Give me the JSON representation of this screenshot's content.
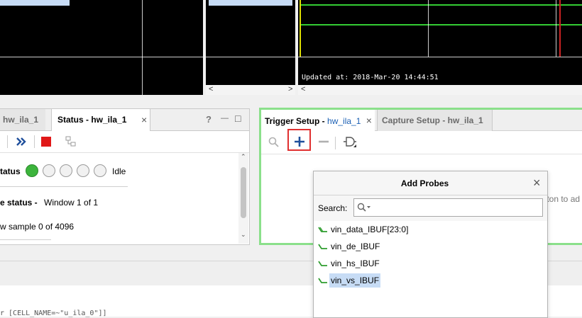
{
  "waveform": {
    "updated_text": "Updated at: 2018-Mar-20 14:44:51",
    "scroll_left": "<",
    "scroll_right": ">"
  },
  "status_panel": {
    "tab_left": "hw_ila_1",
    "tab_active": "Status - hw_ila_1",
    "tab_close": "×",
    "help": "?",
    "minimize": "—",
    "maximize": "□",
    "core_status_label": "tatus",
    "idle_label": "Idle",
    "capture_status_label": "e status -",
    "capture_status_value": "Window 1 of 1",
    "sample_text": "w sample 0 of 4096"
  },
  "trigger_panel": {
    "tab_trigger_prefix": "Trigger Setup - ",
    "tab_trigger_link": "hw_ila_1",
    "tab_close": "×",
    "tab_capture": "Capture Setup - hw_ila_1",
    "hint_text": "tton to ad"
  },
  "dialog": {
    "title": "Add Probes",
    "close": "×",
    "search_label": "Search:",
    "search_value": "",
    "probes": [
      {
        "name": "vin_data_IBUF[23:0]",
        "selected": false
      },
      {
        "name": "vin_de_IBUF",
        "selected": false
      },
      {
        "name": "vin_hs_IBUF",
        "selected": false
      },
      {
        "name": "vin_vs_IBUF",
        "selected": true
      }
    ]
  },
  "tcl": {
    "text": "r [CELL_NAME=~\"u_ila_0\"]]"
  },
  "colors": {
    "waveform_bg": "#000000",
    "green_trace": "#33cc33",
    "red_marker": "#cc2222",
    "yellow_cursor": "#e0e000",
    "selection": "#c7dcf5",
    "trigger_border": "#8be08b",
    "highlight_box": "#e03030"
  }
}
